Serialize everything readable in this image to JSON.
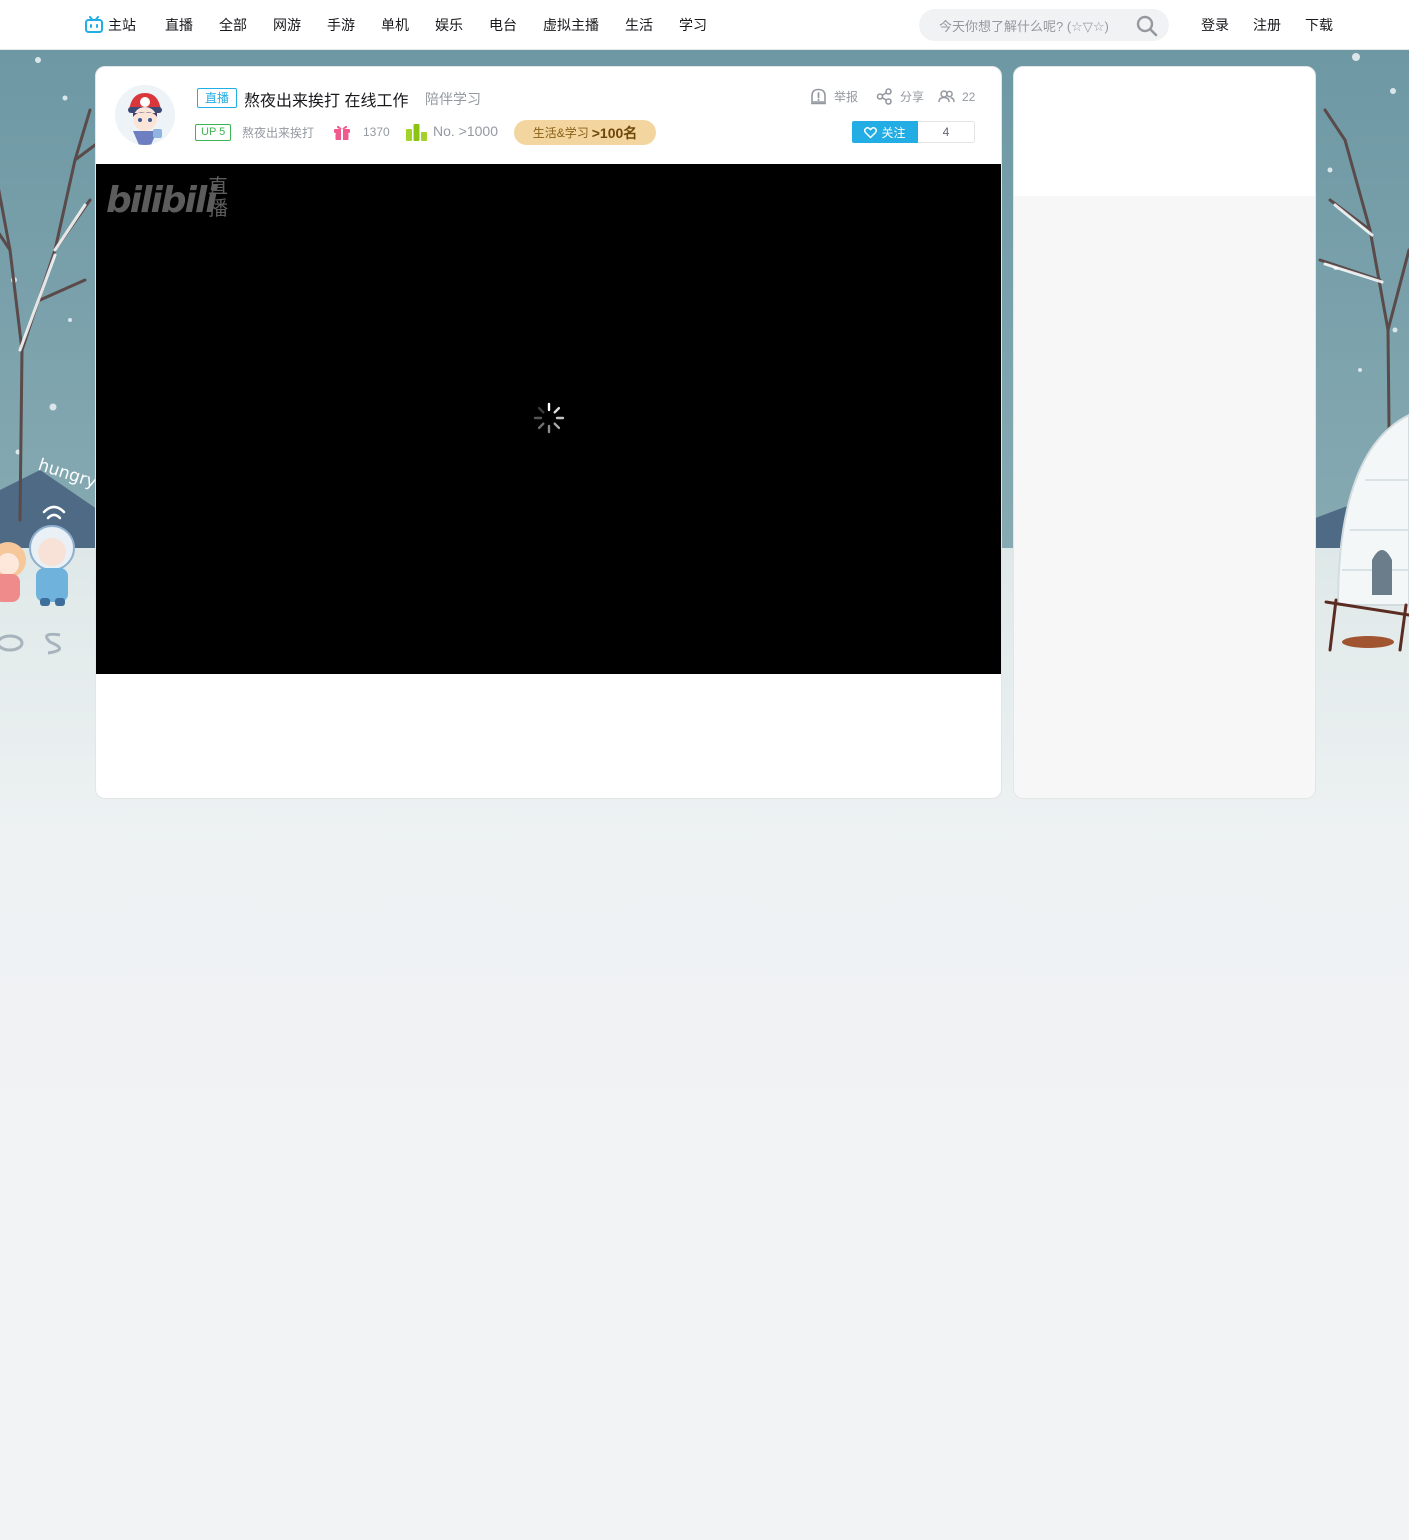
{
  "nav": {
    "home": "主站",
    "links": [
      "直播",
      "全部",
      "网游",
      "手游",
      "单机",
      "娱乐",
      "电台",
      "虚拟主播",
      "生活",
      "学习"
    ],
    "search_placeholder": "今天你想了解什么呢? (☆▽☆)",
    "user_links": [
      "登录",
      "注册",
      "下载"
    ]
  },
  "room": {
    "live_badge": "直播",
    "title": "熬夜出来挨打 在线工作",
    "area": "陪伴学习",
    "up_level": "UP 5",
    "up_name": "熬夜出来挨打",
    "gift_count": "1370",
    "rank": "No. >1000",
    "area_rank_label": "生活&学习",
    "area_rank_value": ">100名",
    "report": "举报",
    "share": "分享",
    "viewers": "22",
    "follow": "关注",
    "follow_count": "4"
  },
  "player": {
    "logo_text": "bilibili",
    "logo_sub_1": "直",
    "logo_sub_2": "播"
  },
  "scene": {
    "doodle_text": "hungry"
  },
  "colors": {
    "brand_blue": "#23ade5",
    "sky": "#6f9ba6",
    "snow": "#e7eeee",
    "up_green": "#3fb34f",
    "gift_pink": "#f05a8c",
    "rank_green": "#a3d22a",
    "area_rank_bg": "#f3d69f"
  },
  "icons": [
    "tv-icon",
    "search-icon",
    "gift-icon",
    "rank-icon",
    "report-icon",
    "share-icon",
    "viewers-icon",
    "heart-icon",
    "loading-spinner"
  ]
}
